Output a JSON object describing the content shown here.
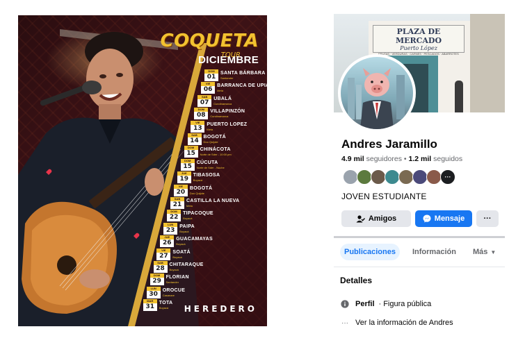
{
  "poster": {
    "title": "COQUETA",
    "subtitle": "TOUR",
    "month": "DICIEMBRE",
    "footer": "HEREDERO",
    "accent": "#f2c230",
    "dates": [
      {
        "day": "DOM",
        "num": "01",
        "city": "SANTA BÁRBARA",
        "dept": "Santander"
      },
      {
        "day": "VIE",
        "num": "06",
        "city": "BARRANCA DE UPIA",
        "dept": "Meta"
      },
      {
        "day": "SAB",
        "num": "07",
        "city": "UBALÁ",
        "dept": "Cundinamarca"
      },
      {
        "day": "DOM",
        "num": "08",
        "city": "VILLAPINZÓN",
        "dept": "Cundinamarca"
      },
      {
        "day": "VIE",
        "num": "13",
        "city": "PUERTO LOPEZ",
        "dept": "Meta"
      },
      {
        "day": "SAB",
        "num": "14",
        "city": "BOGOTÁ",
        "dept": "Doo Quijote"
      },
      {
        "day": "DOM",
        "num": "15",
        "city": "CHINÁCOTA",
        "dept": "Norte de Sder - 10:00 pm"
      },
      {
        "day": "DOM",
        "num": "15",
        "city": "CÚCUTA",
        "dept": "Norte de Sder - Noche"
      },
      {
        "day": "JUE",
        "num": "19",
        "city": "TIBASOSA",
        "dept": "Boyacá"
      },
      {
        "day": "VIE",
        "num": "20",
        "city": "BOGOTÁ",
        "dept": "Doo Quijote"
      },
      {
        "day": "SAB",
        "num": "21",
        "city": "CASTILLA LA NUEVA",
        "dept": "Meta"
      },
      {
        "day": "DOM",
        "num": "22",
        "city": "TIPACOQUE",
        "dept": "Boyacá"
      },
      {
        "day": "LUN",
        "num": "23",
        "city": "PAIPA",
        "dept": "Boyacá"
      },
      {
        "day": "JUE",
        "num": "26",
        "city": "GUACAMAYAS",
        "dept": "Boyacá"
      },
      {
        "day": "VIE",
        "num": "27",
        "city": "SOATÁ",
        "dept": "Boyacá"
      },
      {
        "day": "SAB",
        "num": "28",
        "city": "CHITARAQUE",
        "dept": "Boyacá"
      },
      {
        "day": "DOM",
        "num": "29",
        "city": "FLORIAN",
        "dept": "Santander"
      },
      {
        "day": "LUN",
        "num": "30",
        "city": "OROCUE",
        "dept": "Casanare"
      },
      {
        "day": "MAR",
        "num": "31",
        "city": "TOTA",
        "dept": "Boyacá"
      }
    ]
  },
  "profile": {
    "cover_sign": {
      "line1": "PLAZA DE MERCADO",
      "line2": "Puerto López",
      "line3": "FRUTAS · VERDURAS · CARNES · PESCADOS · ABARROTES"
    },
    "name": "Andres Jaramillo",
    "followers_count": "4.9 mil",
    "followers_label": "seguidores",
    "following_count": "1.2 mil",
    "following_label": "seguidos",
    "bio": "JOVEN ESTUDIANTE",
    "buttons": {
      "friends": "Amigos",
      "message": "Mensaje",
      "more": "···"
    },
    "tabs": [
      {
        "label": "Publicaciones",
        "active": true
      },
      {
        "label": "Información",
        "active": false
      },
      {
        "label": "Más",
        "active": false
      }
    ],
    "details_title": "Detalles",
    "detail_profile_bold": "Perfil",
    "detail_profile_sep": "·",
    "detail_profile_value": "Figura pública",
    "detail_see_more": "Ver la información de Andres",
    "accent": "#1877f2"
  }
}
